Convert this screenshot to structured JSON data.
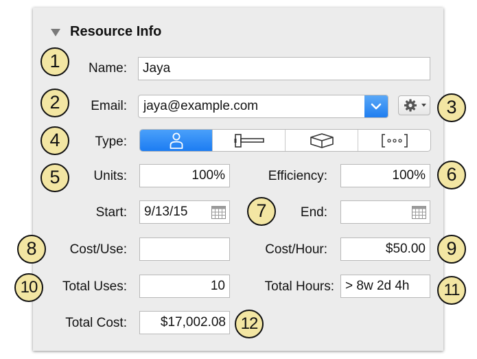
{
  "panel": {
    "title": "Resource Info"
  },
  "fields": {
    "name": {
      "label": "Name:",
      "value": "Jaya"
    },
    "email": {
      "label": "Email:",
      "value": "jaya@example.com"
    },
    "type": {
      "label": "Type:",
      "options": [
        "person-icon",
        "equipment-icon",
        "material-icon",
        "group-icon"
      ],
      "selected": 0
    },
    "units": {
      "label": "Units:",
      "value": "100%"
    },
    "efficiency": {
      "label": "Efficiency:",
      "value": "100%"
    },
    "start": {
      "label": "Start:",
      "value": "9/13/15"
    },
    "end": {
      "label": "End:",
      "value": ""
    },
    "cost_use": {
      "label": "Cost/Use:",
      "value": ""
    },
    "cost_hour": {
      "label": "Cost/Hour:",
      "value": "$50.00"
    },
    "total_uses": {
      "label": "Total Uses:",
      "value": "10"
    },
    "total_hours": {
      "label": "Total Hours:",
      "value": "> 8w 2d 4h"
    },
    "total_cost": {
      "label": "Total Cost:",
      "value": "$17,002.08"
    }
  },
  "callouts": [
    "1",
    "2",
    "3",
    "4",
    "5",
    "6",
    "7",
    "8",
    "9",
    "10",
    "11",
    "12"
  ],
  "colors": {
    "accent": "#1f7ef0",
    "callout_fill": "#f3e6a3",
    "panel_bg": "#ececec"
  }
}
